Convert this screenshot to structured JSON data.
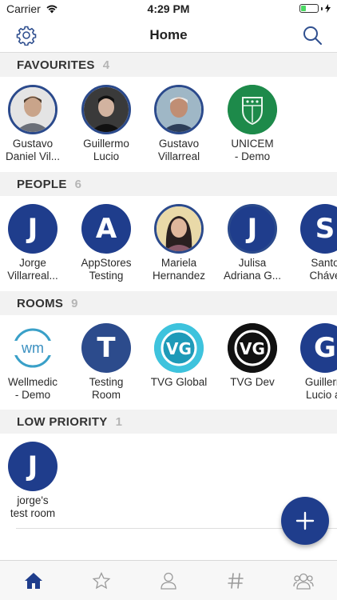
{
  "status_bar": {
    "carrier": "Carrier",
    "time": "4:29 PM",
    "battery_level": 0.3,
    "battery_color": "#4cd964"
  },
  "header": {
    "title": "Home"
  },
  "accent_color": "#1f3d8c",
  "sections": {
    "favourites": {
      "title": "FAVOURITES",
      "count": "4",
      "items": [
        {
          "name": "Gustavo\nDaniel Vil...",
          "avatar": "photo",
          "icon": "person-photo"
        },
        {
          "name": "Guillermo\nLucio",
          "avatar": "photo",
          "icon": "person-photo"
        },
        {
          "name": "Gustavo\nVillarreal",
          "avatar": "photo",
          "icon": "person-photo"
        },
        {
          "name": "UNICEM\n- Demo",
          "avatar": "logo",
          "icon": "unicem-logo"
        }
      ]
    },
    "people": {
      "title": "PEOPLE",
      "count": "6",
      "items": [
        {
          "name": "Jorge\nVillarreal...",
          "letter": "J"
        },
        {
          "name": "AppStores\nTesting",
          "letter": "A"
        },
        {
          "name": "Mariela\nHernandez",
          "avatar": "photo",
          "icon": "person-photo"
        },
        {
          "name": "Julisa\nAdriana G...",
          "letter": "J"
        },
        {
          "name": "Santo\nCháve",
          "letter": "S"
        }
      ]
    },
    "rooms": {
      "title": "ROOMS",
      "count": "9",
      "items": [
        {
          "name": "Wellmedic\n- Demo",
          "logo_text": "wm"
        },
        {
          "name": "Testing\nRoom",
          "letter": "T"
        },
        {
          "name": "TVG Global",
          "logo_text": "VG"
        },
        {
          "name": "TVG Dev",
          "logo_text": "VG"
        },
        {
          "name": "Guillerm\nLucio ar",
          "letter": "G"
        }
      ]
    },
    "low_priority": {
      "title": "LOW PRIORITY",
      "count": "1",
      "items": [
        {
          "name": "jorge's\ntest room",
          "letter": "J"
        }
      ]
    }
  },
  "tabs": [
    {
      "icon": "home-icon",
      "active": true
    },
    {
      "icon": "star-icon",
      "active": false
    },
    {
      "icon": "person-icon",
      "active": false
    },
    {
      "icon": "hash-icon",
      "active": false
    },
    {
      "icon": "group-icon",
      "active": false
    }
  ]
}
